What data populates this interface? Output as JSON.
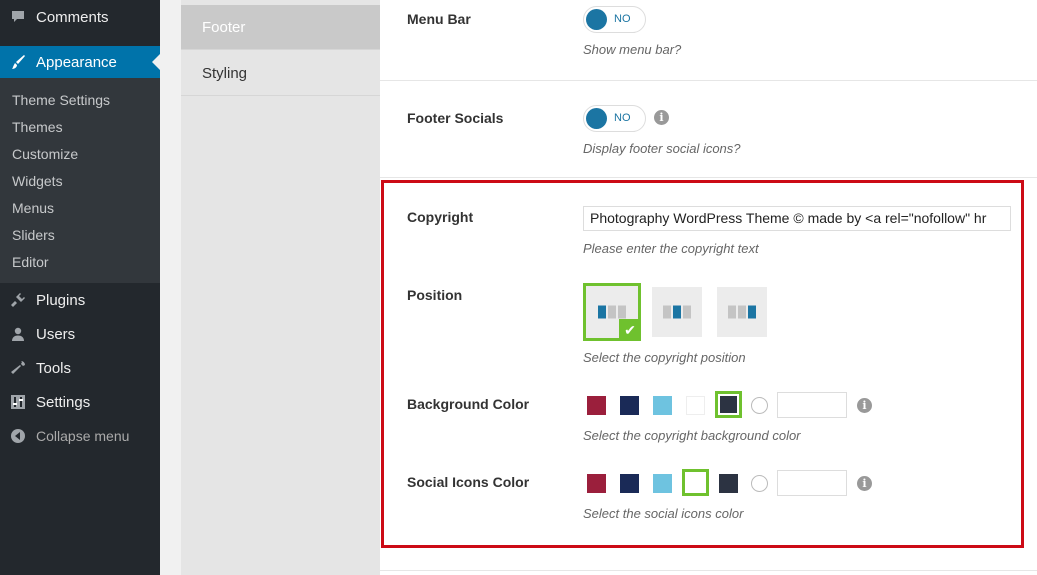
{
  "admin_menu": {
    "comments": "Comments",
    "appearance": "Appearance",
    "submenu": [
      "Theme Settings",
      "Themes",
      "Customize",
      "Widgets",
      "Menus",
      "Sliders",
      "Editor"
    ],
    "plugins": "Plugins",
    "users": "Users",
    "tools": "Tools",
    "settings": "Settings",
    "collapse": "Collapse menu"
  },
  "sections": {
    "footer": "Footer",
    "styling": "Styling"
  },
  "options": {
    "menu_bar": {
      "label": "Menu Bar",
      "toggle": "NO",
      "desc": "Show menu bar?"
    },
    "footer_socials": {
      "label": "Footer Socials",
      "toggle": "NO",
      "desc": "Display footer social icons?"
    },
    "copyright": {
      "label": "Copyright",
      "value": "Photography WordPress Theme © made by <a rel=\"nofollow\" hr",
      "desc": "Please enter the copyright text"
    },
    "position": {
      "label": "Position",
      "desc": "Select the copyright position",
      "selected_index": 0
    },
    "background_color": {
      "label": "Background Color",
      "desc": "Select the copyright background color",
      "selected_swatch": "#2c3342"
    },
    "social_icons_color": {
      "label": "Social Icons Color",
      "desc": "Select the social icons color",
      "selected_swatch": "#ffffff"
    }
  },
  "info_glyph": "i",
  "check_glyph": "✔",
  "swatches": [
    "#9b1f3c",
    "#1a2a57",
    "#6ec3e0",
    "#ffffff",
    "#2c3342"
  ],
  "colors": {
    "accent": "#0073aa",
    "toggle": "#1b75a3",
    "selected_outline": "#6fc12e",
    "highlight_frame": "#cc0a16"
  }
}
